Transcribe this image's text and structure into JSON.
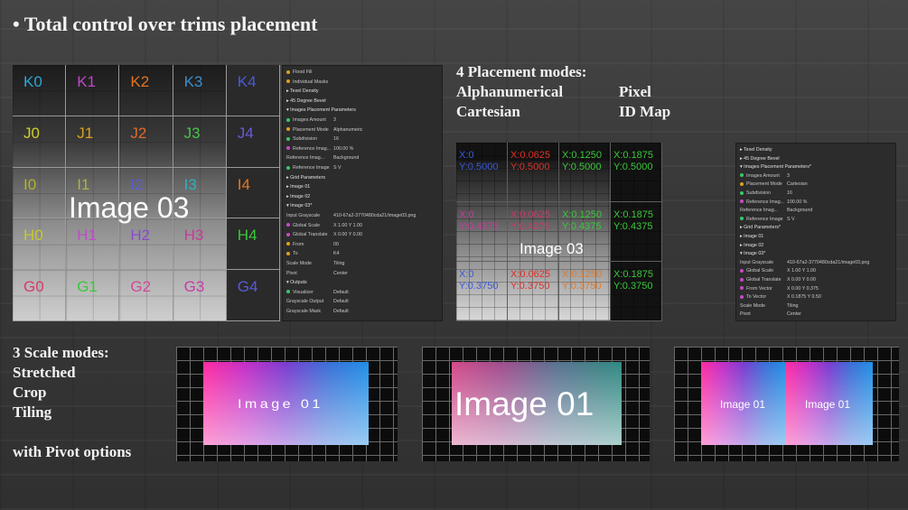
{
  "headline": "• Total control over trims placement",
  "placement": {
    "heading": "4 Placement modes:",
    "modes": [
      "Alphanumerical",
      "Pixel",
      "Cartesian",
      "ID Map"
    ]
  },
  "scale": {
    "heading": "3 Scale modes:",
    "modes": [
      "Stretched",
      "Crop",
      "Tiling"
    ],
    "pivot_note": "with Pivot options",
    "previews": [
      "Image 01",
      "Image 01",
      "Image 01",
      "Image 01"
    ]
  },
  "grid_a": {
    "labels": [
      {
        "t": "K0",
        "c": "#29a8d8"
      },
      {
        "t": "K1",
        "c": "#c247c7"
      },
      {
        "t": "K2",
        "c": "#e6731f"
      },
      {
        "t": "K3",
        "c": "#3a8fcf"
      },
      {
        "t": "K4",
        "c": "#4a5bd8"
      },
      {
        "t": "J0",
        "c": "#cfcf2a"
      },
      {
        "t": "J1",
        "c": "#d8a21f"
      },
      {
        "t": "J2",
        "c": "#e0692a"
      },
      {
        "t": "J3",
        "c": "#46c34a"
      },
      {
        "t": "J4",
        "c": "#6a5ad8"
      },
      {
        "t": "I0",
        "c": "#b3b32a"
      },
      {
        "t": "I1",
        "c": "#b0b04a"
      },
      {
        "t": "I2",
        "c": "#5a5ad8"
      },
      {
        "t": "I3",
        "c": "#2ab3c0"
      },
      {
        "t": "I4",
        "c": "#e07a2a"
      },
      {
        "t": "H0",
        "c": "#c8c82a"
      },
      {
        "t": "H1",
        "c": "#c04ac8"
      },
      {
        "t": "H2",
        "c": "#8a4ad0"
      },
      {
        "t": "H3",
        "c": "#c83a9a"
      },
      {
        "t": "H4",
        "c": "#3ac83a"
      },
      {
        "t": "G0",
        "c": "#d83a6a"
      },
      {
        "t": "G1",
        "c": "#3ac83a"
      },
      {
        "t": "G2",
        "c": "#d04a9a"
      },
      {
        "t": "G3",
        "c": "#c83aa8"
      },
      {
        "t": "G4",
        "c": "#5a5ad8"
      }
    ],
    "center_label": "Image 03"
  },
  "panel_a": {
    "rows": [
      {
        "k": "Flood Fill",
        "dot": "#e0a020"
      },
      {
        "k": "Individual Masks",
        "dot": "#e0a020"
      },
      {
        "k": "▸ Texel Density",
        "sec": true
      },
      {
        "k": "▸ 45 Degree Bevel",
        "sec": true
      },
      {
        "k": "▾ Images Placement Parameters",
        "sec": true
      },
      {
        "k": "Images Amount",
        "v": "3",
        "dot": "#3ac86a"
      },
      {
        "k": "Placement Mode",
        "v": "Alphanumeric",
        "dot": "#e0a020"
      },
      {
        "k": "Subdivision",
        "v": "16",
        "dot": "#3ac86a"
      },
      {
        "k": "Reference Imag...",
        "v": "100.00 %",
        "dot": "#c84ac8"
      },
      {
        "k": "Reference Imag...",
        "v": "Background"
      },
      {
        "k": "Reference Image",
        "v": "S  V",
        "dot": "#3ac86a"
      },
      {
        "k": "▸ Grid Parameters",
        "sec": true
      },
      {
        "k": "▸ Image 01",
        "sec": true
      },
      {
        "k": "▸ Image 02",
        "sec": true
      },
      {
        "k": "▾ Image 03*",
        "sec": true
      },
      {
        "k": "Input Grayscale",
        "v": "410-67a2-3770480cda21/image03.png"
      },
      {
        "k": "Global Scale",
        "v": "X 1.00   Y 1.00",
        "dot": "#c84ac8"
      },
      {
        "k": "Global Translate",
        "v": "X 0.00   Y 0.00",
        "dot": "#c84ac8"
      },
      {
        "k": "From",
        "v": "00",
        "dot": "#e0a020"
      },
      {
        "k": "To",
        "v": "K4",
        "dot": "#e0a020"
      },
      {
        "k": "Scale Mode",
        "v": "Tiling"
      },
      {
        "k": "Pivot",
        "v": "Center"
      },
      {
        "k": "▾ Outputs",
        "sec": true
      },
      {
        "k": "Visualizer",
        "v": "Default",
        "dot": "#3ac86a"
      },
      {
        "k": "Grayscale Output",
        "v": "Default"
      },
      {
        "k": "Grayscale Mask",
        "v": "Default"
      }
    ]
  },
  "grid_b": {
    "coords": [
      {
        "x": "X:0",
        "y": "Y:0.5000",
        "c": "#3a5ad8"
      },
      {
        "x": "X:0.0625",
        "y": "Y:0.5000",
        "c": "#e0302a"
      },
      {
        "x": "X:0.1250",
        "y": "Y:0.5000",
        "c": "#3ac83a"
      },
      {
        "x": "X:0.1875",
        "y": "Y:0.5000",
        "c": "#3ac83a"
      },
      {
        "x": "X:0",
        "y": "Y:0.4375",
        "c": "#c83a9a"
      },
      {
        "x": "X:0.0625",
        "y": "Y:0.4375",
        "c": "#c83a6a"
      },
      {
        "x": "X:0.1250",
        "y": "Y:0.4375",
        "c": "#3ac83a"
      },
      {
        "x": "X:0.1875",
        "y": "Y:0.4375",
        "c": "#3ac83a"
      },
      {
        "x": "X:0",
        "y": "Y:0.3750",
        "c": "#3a5ad8"
      },
      {
        "x": "X:0.0625",
        "y": "Y:0.3750",
        "c": "#e0302a"
      },
      {
        "x": "X:0.1250",
        "y": "Y:0.3750",
        "c": "#e07a2a"
      },
      {
        "x": "X:0.1875",
        "y": "Y:0.3750",
        "c": "#3ac83a"
      }
    ],
    "center_label": "Image 03"
  },
  "panel_b": {
    "rows": [
      {
        "k": "▸ Texel Density",
        "sec": true
      },
      {
        "k": "▸ 45 Degree Bevel",
        "sec": true
      },
      {
        "k": "▾ Images Placement Parameters*",
        "sec": true
      },
      {
        "k": "Images Amount",
        "v": "3",
        "dot": "#3ac86a"
      },
      {
        "k": "Placement Mode",
        "v": "Cartesian",
        "dot": "#e0a020"
      },
      {
        "k": "Subdivision",
        "v": "16",
        "dot": "#3ac86a"
      },
      {
        "k": "Reference Imag...",
        "v": "100.00 %",
        "dot": "#c84ac8"
      },
      {
        "k": "Reference Imag...",
        "v": "Background"
      },
      {
        "k": "Reference Image",
        "v": "S  V",
        "dot": "#3ac86a"
      },
      {
        "k": "▸ Grid Parameters*",
        "sec": true
      },
      {
        "k": "▸ Image 01",
        "sec": true
      },
      {
        "k": "▸ Image 02",
        "sec": true
      },
      {
        "k": "▾ Image 03*",
        "sec": true
      },
      {
        "k": "Input Grayscale",
        "v": "410-67a2-3770480cda21/image03.png"
      },
      {
        "k": "Global Scale",
        "v": "X 1.00   Y 1.00",
        "dot": "#c84ac8"
      },
      {
        "k": "Global Translate",
        "v": "X 0.00   Y 0.00",
        "dot": "#c84ac8"
      },
      {
        "k": "From Vector",
        "v": "X 0.00   Y 0.375",
        "dot": "#c84ac8"
      },
      {
        "k": "To Vector",
        "v": "X 0.1875   Y 0.50",
        "dot": "#c84ac8"
      },
      {
        "k": "Scale Mode",
        "v": "Tiling"
      },
      {
        "k": "Pivot",
        "v": "Center"
      }
    ]
  }
}
